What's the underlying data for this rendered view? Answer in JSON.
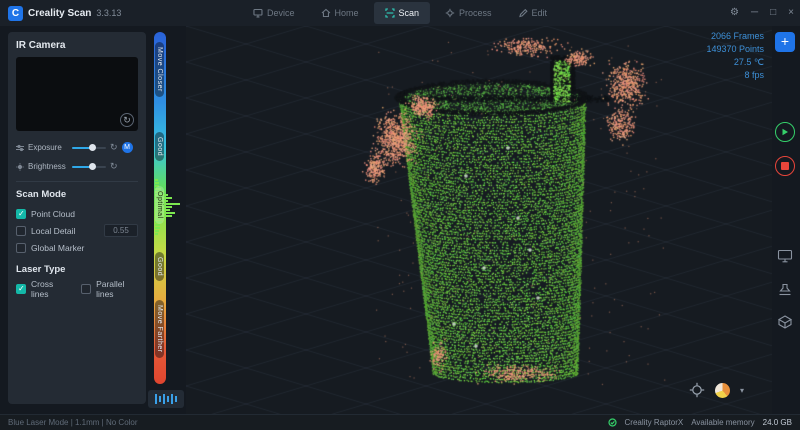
{
  "app": {
    "logo": "C",
    "title": "Creality Scan",
    "version": "3.3.13"
  },
  "tabs": [
    {
      "label": "Device",
      "active": false
    },
    {
      "label": "Home",
      "active": false
    },
    {
      "label": "Scan",
      "active": true
    },
    {
      "label": "Process",
      "active": false
    },
    {
      "label": "Edit",
      "active": false
    }
  ],
  "left_panel": {
    "title": "IR Camera",
    "exposure": {
      "label": "Exposure",
      "auto_badge": "M"
    },
    "brightness": {
      "label": "Brightness"
    },
    "scan_mode": {
      "title": "Scan Mode",
      "options": [
        {
          "label": "Point Cloud",
          "checked": true
        },
        {
          "label": "Local Detail",
          "checked": false,
          "value": "0.55"
        },
        {
          "label": "Global Marker",
          "checked": false
        }
      ]
    },
    "laser_type": {
      "title": "Laser Type",
      "options": [
        {
          "label": "Cross lines",
          "checked": true
        },
        {
          "label": "Parallel lines",
          "checked": false
        }
      ]
    }
  },
  "gauge": {
    "zones": [
      {
        "label": "Move Closer"
      },
      {
        "label": "Good"
      },
      {
        "label": "Optimal"
      },
      {
        "label": "Good"
      },
      {
        "label": "Move Farther"
      }
    ]
  },
  "viewport": {
    "stats": {
      "frames": "2066 Frames",
      "points": "149370 Points",
      "temperature": "27.5 ℃",
      "fps": "8 fps"
    },
    "cloud_colors": {
      "object": "#7ce850",
      "noise": "#e89a78",
      "dark": "#15181b"
    }
  },
  "statusbar": {
    "mode_info": "Blue Laser Mode | 1.1mm | No Color",
    "device_name": "Creality RaptorX",
    "memory_label": "Available memory",
    "memory_value": "24.0 GB"
  }
}
